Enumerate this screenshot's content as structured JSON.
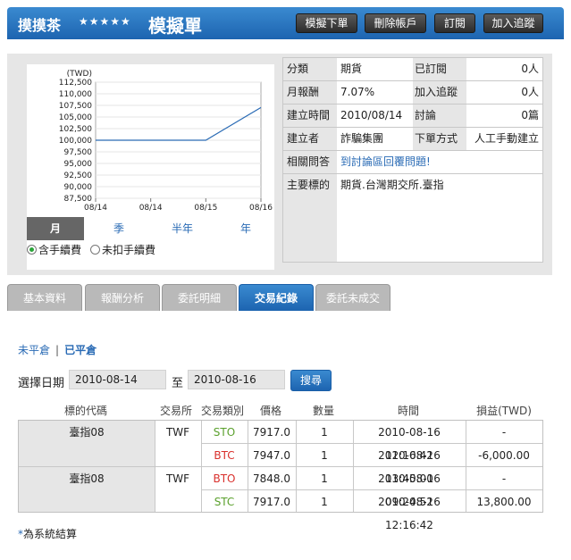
{
  "header": {
    "name": "摸摸茶",
    "stars": "★★★★★",
    "title": "模擬單",
    "buttons": [
      "模擬下單",
      "刪除帳戶",
      "訂閱",
      "加入追蹤"
    ]
  },
  "chart_data": {
    "type": "line",
    "ylabel": "(TWD)",
    "y_ticks": [
      "112,500",
      "110,000",
      "107,500",
      "105,000",
      "102,500",
      "100,000",
      "97,500",
      "95,000",
      "92,500",
      "90,000",
      "87,500"
    ],
    "ylim": [
      87500,
      112500
    ],
    "x_ticks": [
      "08/14",
      "08/14",
      "08/15",
      "08/16"
    ],
    "series": [
      {
        "values": [
          100000,
          100000,
          100000,
          107050
        ]
      }
    ],
    "color": "#2a6bb5"
  },
  "periods": [
    "月",
    "季",
    "半年",
    "年"
  ],
  "fee": {
    "with": "含手續費",
    "without": "未扣手續費"
  },
  "info": {
    "category_label": "分類",
    "category": "期貨",
    "subscribed_label": "已訂閱",
    "subscribed": "0人",
    "monthly_label": "月報酬",
    "monthly": "7.07%",
    "following_label": "加入追蹤",
    "following": "0人",
    "created_label": "建立時間",
    "created": "2010/08/14",
    "discuss_label": "討論",
    "discuss": "0篇",
    "creator_label": "建立者",
    "creator": "詐騙集團",
    "order_label": "下單方式",
    "order": "人工手動建立",
    "related_label": "相關問答",
    "related": "到討論區回覆問題!",
    "target_label": "主要標的",
    "target": "期貨.台灣期交所.臺指"
  },
  "tabs": [
    "基本資料",
    "報酬分析",
    "委託明細",
    "交易紀錄",
    "委託未成交"
  ],
  "switch": {
    "open": "未平倉",
    "sep": "|",
    "closed": "已平倉"
  },
  "date_filter": {
    "label": "選擇日期",
    "from": "2010-08-14",
    "to_label": "至",
    "to": "2010-08-16",
    "search": "搜尋"
  },
  "table": {
    "headers": [
      "標的代碼",
      "交易所",
      "交易類別",
      "價格",
      "數量",
      "時間",
      "損益(TWD)"
    ],
    "groups": [
      {
        "symbol": "臺指08",
        "exchange": "TWF",
        "rows": [
          {
            "type": "STO",
            "price": "7917.0",
            "qty": "1",
            "time": "2010-08-16 12:16:42",
            "pnl": "-"
          },
          {
            "type": "BTC",
            "price": "7947.0",
            "qty": "1",
            "time": "2010-08-16 13:45:00",
            "pnl": "-6,000.00"
          }
        ]
      },
      {
        "symbol": "臺指08",
        "exchange": "TWF",
        "rows": [
          {
            "type": "BTO",
            "price": "7848.0",
            "qty": "1",
            "time": "2010-08-16 09:24:52",
            "pnl": "-"
          },
          {
            "type": "STC",
            "price": "7917.0",
            "qty": "1",
            "time": "2010-08-16 12:16:42",
            "pnl": "13,800.00"
          }
        ]
      }
    ],
    "type_colors": {
      "STO": "#5aa02c",
      "STC": "#5aa02c",
      "BTC": "#d9302c",
      "BTO": "#d9302c"
    }
  },
  "note": {
    "star": "*",
    "text": "為系統結算"
  }
}
